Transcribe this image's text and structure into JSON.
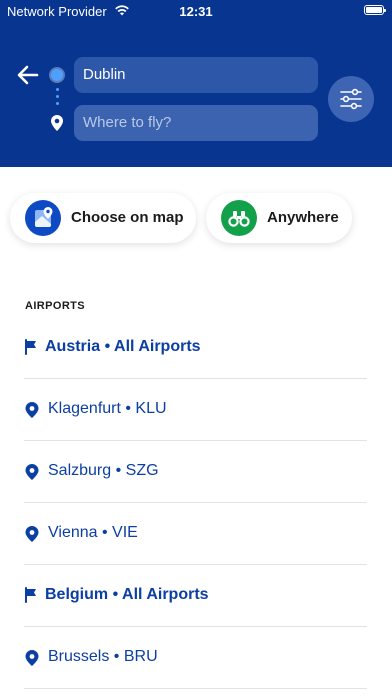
{
  "status_bar": {
    "carrier": "Network Provider",
    "time": "12:31"
  },
  "search": {
    "from_value": "Dublin",
    "to_placeholder": "Where to fly?"
  },
  "quick_actions": {
    "map_label": "Choose on map",
    "anywhere_label": "Anywhere"
  },
  "airports": {
    "title": "AIRPORTS",
    "items": [
      {
        "type": "country",
        "label": "Austria • All Airports"
      },
      {
        "type": "airport",
        "label": "Klagenfurt • KLU"
      },
      {
        "type": "airport",
        "label": "Salzburg • SZG"
      },
      {
        "type": "airport",
        "label": "Vienna • VIE"
      },
      {
        "type": "country",
        "label": "Belgium • All Airports"
      },
      {
        "type": "airport",
        "label": "Brussels • BRU"
      }
    ]
  },
  "colors": {
    "brand": "#073590",
    "link": "#0c3fa4",
    "map_icon": "#0e4ac4",
    "anywhere_icon": "#12a04a",
    "route_dot": "#4ea0ff"
  },
  "icons": [
    "back-arrow-icon",
    "wifi-icon",
    "battery-icon",
    "origin-dot-icon",
    "destination-pin-icon",
    "filter-sliders-icon",
    "map-icon",
    "binoculars-icon",
    "flag-icon",
    "location-pin-icon"
  ]
}
